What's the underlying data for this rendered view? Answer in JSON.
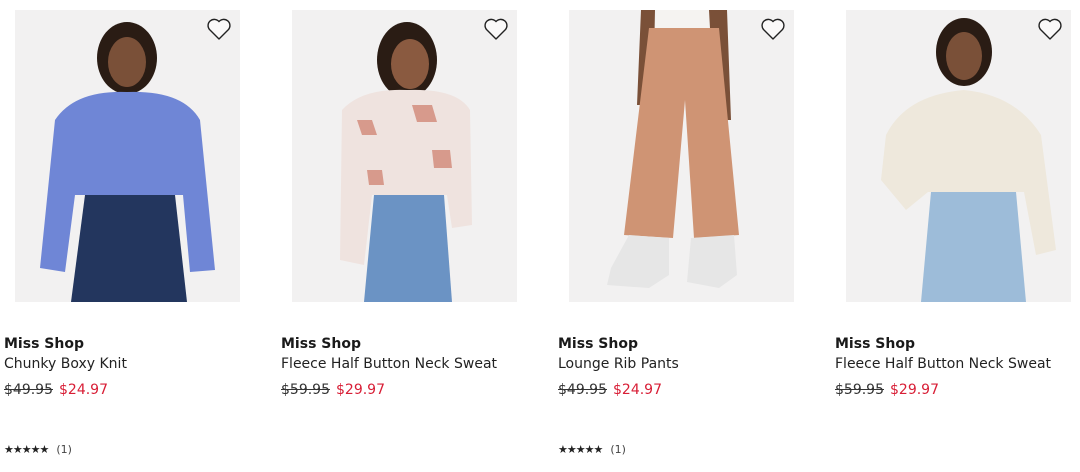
{
  "colors": {
    "sale": "#d81e36",
    "text": "#1a1a1a",
    "image_bg": "#f2f1f1"
  },
  "products": [
    {
      "brand": "Miss Shop",
      "name": "Chunky Boxy Knit",
      "was_price": "$49.95",
      "price": "$24.97",
      "has_rating": true,
      "stars": "★★★★★",
      "review_count": "(1)",
      "wishlist_icon": "heart-outline-icon",
      "image_top_color": "#6f86d6",
      "image_bottom_color": "#23365e",
      "image_skin": "#7a5038"
    },
    {
      "brand": "Miss Shop",
      "name": "Fleece Half Button Neck Sweat",
      "was_price": "$59.95",
      "price": "$29.97",
      "has_rating": false,
      "stars": "",
      "review_count": "",
      "wishlist_icon": "heart-outline-icon",
      "image_top_color": "#efe3df",
      "image_bottom_color": "#6b93c4",
      "image_skin": "#8a5a40"
    },
    {
      "brand": "Miss Shop",
      "name": "Lounge Rib Pants",
      "was_price": "$49.95",
      "price": "$24.97",
      "has_rating": true,
      "stars": "★★★★★",
      "review_count": "(1)",
      "wishlist_icon": "heart-outline-icon",
      "image_top_color": "#f5f3f1",
      "image_bottom_color": "#cf9474",
      "image_skin": "#7a5038"
    },
    {
      "brand": "Miss Shop",
      "name": "Fleece Half Button Neck Sweat",
      "was_price": "$59.95",
      "price": "$29.97",
      "has_rating": false,
      "stars": "",
      "review_count": "",
      "wishlist_icon": "heart-outline-icon",
      "image_top_color": "#eee8dc",
      "image_bottom_color": "#9dbcd9",
      "image_skin": "#7a5038"
    }
  ]
}
